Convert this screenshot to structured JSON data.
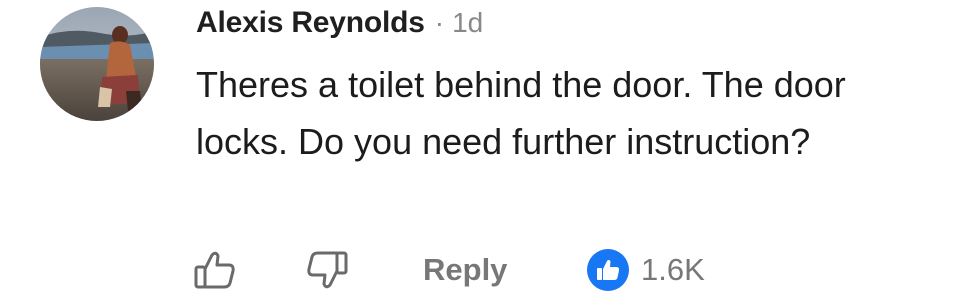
{
  "comment": {
    "author": "Alexis Reynolds",
    "separator": "·",
    "timestamp": "1d",
    "text": "Theres a toilet behind the door. The door locks. Do you need further instruction?"
  },
  "actions": {
    "reply_label": "Reply",
    "reaction_count": "1.6K",
    "like_icon": "thumbs-up-outline",
    "dislike_icon": "thumbs-down-outline",
    "reaction_icon": "blue-thumbs-up-circle"
  },
  "colors": {
    "text": "#1c1c1c",
    "muted": "#888888",
    "action": "#777777",
    "reaction_blue": "#1877f2"
  }
}
